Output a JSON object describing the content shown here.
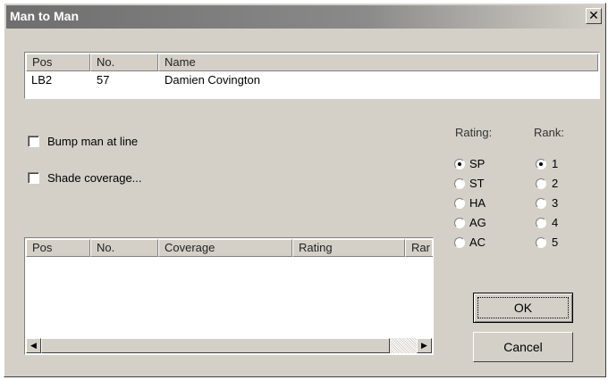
{
  "window": {
    "title": "Man to Man",
    "close_glyph": "✕"
  },
  "player_list": {
    "columns": [
      "Pos",
      "No.",
      "Name"
    ],
    "rows": [
      {
        "pos": "LB2",
        "no": "57",
        "name": "Damien Covington"
      }
    ]
  },
  "options": {
    "bump_label": "Bump man at line",
    "bump_checked": false,
    "shade_label": "Shade coverage...",
    "shade_checked": false
  },
  "coverage_list": {
    "columns": [
      "Pos",
      "No.",
      "Coverage",
      "Rating",
      "Rar"
    ],
    "rows": []
  },
  "rating": {
    "label": "Rating:",
    "options": [
      "SP",
      "ST",
      "HA",
      "AG",
      "AC"
    ],
    "selected": "SP"
  },
  "rank": {
    "label": "Rank:",
    "options": [
      "1",
      "2",
      "3",
      "4",
      "5"
    ],
    "selected": "1"
  },
  "buttons": {
    "ok": "OK",
    "cancel": "Cancel"
  },
  "scrollbar": {
    "left_arrow": "◀",
    "right_arrow": "▶"
  }
}
